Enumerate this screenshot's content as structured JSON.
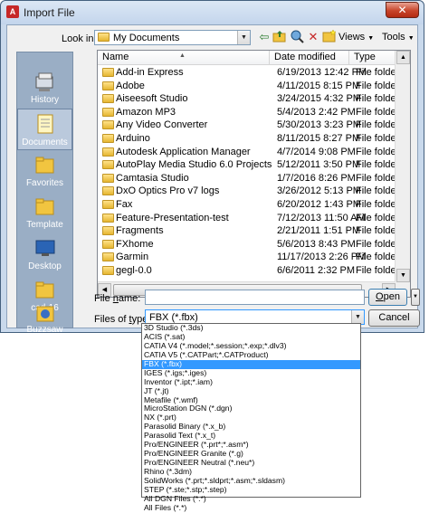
{
  "window": {
    "title": "Import File",
    "close": "✕",
    "app_icon_letter": "A"
  },
  "toolbar": {
    "look_in_label": "Look in:",
    "look_in_value": "My Documents",
    "views_label": "Views",
    "tools_label": "Tools"
  },
  "places": [
    {
      "label": "History",
      "icon": "history-icon"
    },
    {
      "label": "Documents",
      "icon": "documents-icon",
      "active": true
    },
    {
      "label": "Favorites",
      "icon": "favorites-icon"
    },
    {
      "label": "Template",
      "icon": "template-folder-icon"
    },
    {
      "label": "Desktop",
      "icon": "desktop-icon"
    },
    {
      "label": "cad-16",
      "icon": "folder-icon"
    },
    {
      "label": "Buzzsaw",
      "icon": "buzzsaw-icon"
    }
  ],
  "file_list": {
    "columns": [
      "Name",
      "Date modified",
      "Type"
    ],
    "rows": [
      {
        "name": "Add-in Express",
        "date": "6/19/2013 12:42 PM",
        "type": "File folder"
      },
      {
        "name": "Adobe",
        "date": "4/11/2015 8:15 PM",
        "type": "File folder"
      },
      {
        "name": "Aiseesoft Studio",
        "date": "3/24/2015 4:32 PM",
        "type": "File folder"
      },
      {
        "name": "Amazon MP3",
        "date": "5/4/2013 2:42 PM",
        "type": "File folder"
      },
      {
        "name": "Any Video Converter",
        "date": "5/30/2013 3:23 PM",
        "type": "File folder"
      },
      {
        "name": "Arduino",
        "date": "8/11/2015 8:27 PM",
        "type": "File folder"
      },
      {
        "name": "Autodesk Application Manager",
        "date": "4/7/2014 9:08 PM",
        "type": "File folder"
      },
      {
        "name": "AutoPlay Media Studio 6.0 Projects",
        "date": "5/12/2011 3:50 PM",
        "type": "File folder"
      },
      {
        "name": "Camtasia Studio",
        "date": "1/7/2016 8:26 PM",
        "type": "File folder"
      },
      {
        "name": "DxO Optics Pro v7 logs",
        "date": "3/26/2012 5:13 PM",
        "type": "File folder"
      },
      {
        "name": "Fax",
        "date": "6/20/2012 1:43 PM",
        "type": "File folder"
      },
      {
        "name": "Feature-Presentation-test",
        "date": "7/12/2013 11:50 AM",
        "type": "File folder"
      },
      {
        "name": "Fragments",
        "date": "2/21/2011 1:51 PM",
        "type": "File folder"
      },
      {
        "name": "FXhome",
        "date": "5/6/2013 8:43 PM",
        "type": "File folder"
      },
      {
        "name": "Garmin",
        "date": "11/17/2013 2:26 PM",
        "type": "File folder"
      },
      {
        "name": "gegl-0.0",
        "date": "6/6/2011 2:32 PM",
        "type": "File folder"
      }
    ]
  },
  "form": {
    "file_name_label_underlined": "n",
    "file_name_label_pre": "File ",
    "file_name_label_post": "ame:",
    "file_name_value": "",
    "file_type_label_pre": "Files of ",
    "file_type_label_underlined": "t",
    "file_type_label_post": "ype:",
    "file_type_value": "FBX (*.fbx)",
    "open_pre": "",
    "open_underlined": "O",
    "open_post": "pen",
    "cancel_label": "Cancel"
  },
  "file_types": [
    "3D Studio (*.3ds)",
    "ACIS (*.sat)",
    "CATIA V4 (*.model;*.session;*.exp;*.dlv3)",
    "CATIA V5 (*.CATPart;*.CATProduct)",
    "FBX (*.fbx)",
    "IGES (*.igs;*.iges)",
    "Inventor (*.ipt;*.iam)",
    "JT (*.jt)",
    "Metafile (*.wmf)",
    "MicroStation DGN (*.dgn)",
    "NX (*.prt)",
    "Parasolid Binary (*.x_b)",
    "Parasolid Text (*.x_t)",
    "Pro/ENGINEER (*.prt*;*.asm*)",
    "Pro/ENGINEER Granite (*.g)",
    "Pro/ENGINEER Neutral (*.neu*)",
    "Rhino (*.3dm)",
    "SolidWorks (*.prt;*.sldprt;*.asm;*.sldasm)",
    "STEP (*.ste;*.stp;*.step)",
    "All DGN Files (*.*)",
    "All Files (*.*)"
  ],
  "selected_file_type_index": 4
}
